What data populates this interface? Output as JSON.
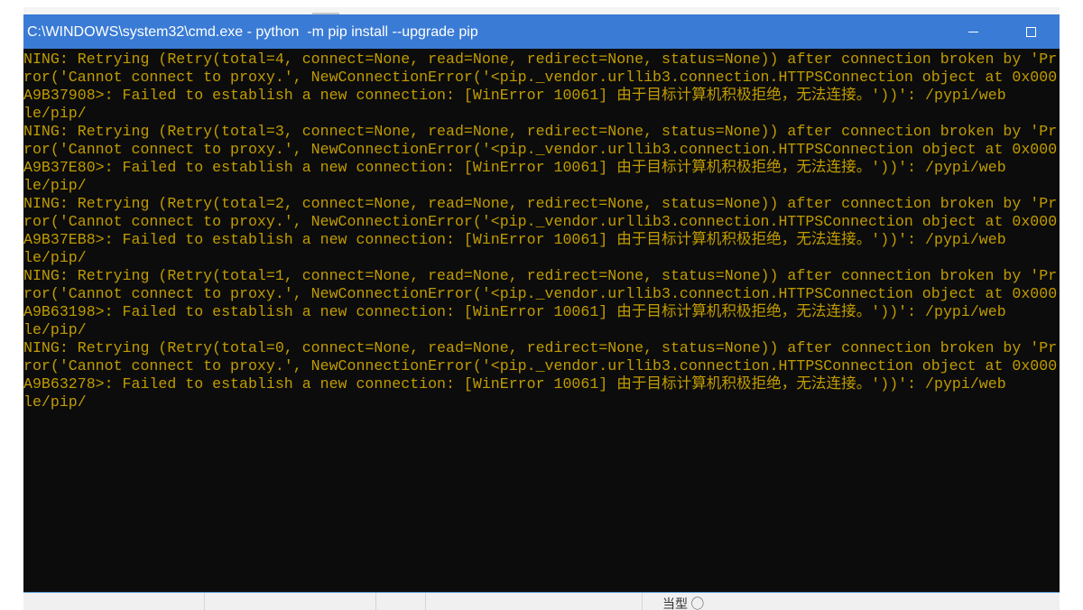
{
  "window": {
    "title": "C:\\WINDOWS\\system32\\cmd.exe - python  -m pip install --upgrade pip",
    "controls": [
      {
        "name": "minimize",
        "icon": "minimize-icon"
      },
      {
        "name": "maximize",
        "icon": "maximize-icon"
      }
    ]
  },
  "colors": {
    "titlebar": "#3a7bd5",
    "console_bg": "#0c0c0c",
    "console_text": "#c19c00"
  },
  "console": {
    "lines": [
      "NING: Retrying (Retry(total=4, connect=None, read=None, redirect=None, status=None)) after connection broken by 'Pr",
      "ror('Cannot connect to proxy.', NewConnectionError('<pip._vendor.urllib3.connection.HTTPSConnection object at 0x000",
      "A9B37908>: Failed to establish a new connection: [WinError 10061] 由于目标计算机积极拒绝，无法连接。'))': /pypi/web",
      "le/pip/",
      "NING: Retrying (Retry(total=3, connect=None, read=None, redirect=None, status=None)) after connection broken by 'Pr",
      "ror('Cannot connect to proxy.', NewConnectionError('<pip._vendor.urllib3.connection.HTTPSConnection object at 0x000",
      "A9B37E80>: Failed to establish a new connection: [WinError 10061] 由于目标计算机积极拒绝，无法连接。'))': /pypi/web",
      "le/pip/",
      "NING: Retrying (Retry(total=2, connect=None, read=None, redirect=None, status=None)) after connection broken by 'Pr",
      "ror('Cannot connect to proxy.', NewConnectionError('<pip._vendor.urllib3.connection.HTTPSConnection object at 0x000",
      "A9B37EB8>: Failed to establish a new connection: [WinError 10061] 由于目标计算机积极拒绝，无法连接。'))': /pypi/web",
      "le/pip/",
      "NING: Retrying (Retry(total=1, connect=None, read=None, redirect=None, status=None)) after connection broken by 'Pr",
      "ror('Cannot connect to proxy.', NewConnectionError('<pip._vendor.urllib3.connection.HTTPSConnection object at 0x000",
      "A9B63198>: Failed to establish a new connection: [WinError 10061] 由于目标计算机积极拒绝，无法连接。'))': /pypi/web",
      "le/pip/",
      "NING: Retrying (Retry(total=0, connect=None, read=None, redirect=None, status=None)) after connection broken by 'Pr",
      "ror('Cannot connect to proxy.', NewConnectionError('<pip._vendor.urllib3.connection.HTTPSConnection object at 0x000",
      "A9B63278>: Failed to establish a new connection: [WinError 10061] 由于目标计算机积极拒绝，无法连接。'))': /pypi/web",
      "le/pip/"
    ]
  },
  "background": {
    "peek_text": "当型 ◯"
  }
}
